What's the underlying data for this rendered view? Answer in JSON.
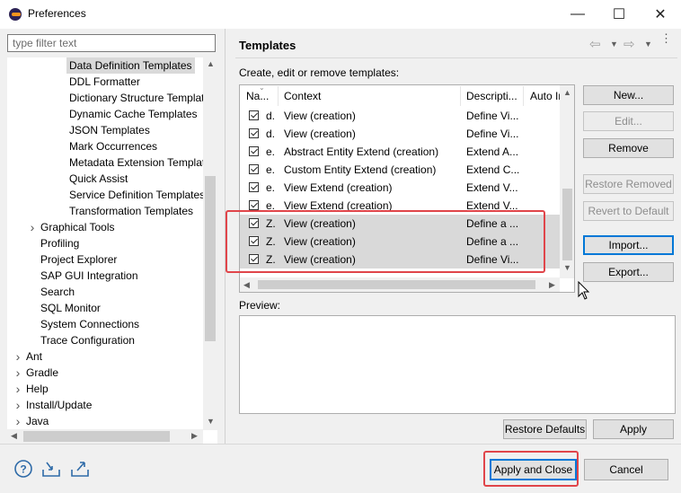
{
  "window": {
    "title": "Preferences",
    "controls": {
      "minimize": "—",
      "maximize": "☐",
      "close": "✕"
    }
  },
  "filter": {
    "placeholder": "type filter text",
    "value": ""
  },
  "tree": {
    "items": [
      {
        "label": "Data Definition Templates",
        "selected": true
      },
      {
        "label": "DDL Formatter"
      },
      {
        "label": "Dictionary Structure Templat"
      },
      {
        "label": "Dynamic Cache Templates"
      },
      {
        "label": "JSON Templates"
      },
      {
        "label": "Mark Occurrences"
      },
      {
        "label": "Metadata Extension Templat"
      },
      {
        "label": "Quick Assist"
      },
      {
        "label": "Service Definition Templates"
      },
      {
        "label": "Transformation Templates"
      },
      {
        "label": "Graphical Tools",
        "expandable": true
      },
      {
        "label": "Profiling"
      },
      {
        "label": "Project Explorer"
      },
      {
        "label": "SAP GUI Integration"
      },
      {
        "label": "Search"
      },
      {
        "label": "SQL Monitor"
      },
      {
        "label": "System Connections"
      },
      {
        "label": "Trace Configuration"
      },
      {
        "label": "Ant",
        "expandable": true
      },
      {
        "label": "Gradle",
        "expandable": true
      },
      {
        "label": "Help",
        "expandable": true
      },
      {
        "label": "Install/Update",
        "expandable": true
      },
      {
        "label": "Java",
        "expandable": true
      }
    ]
  },
  "page": {
    "title": "Templates",
    "description": "Create, edit or remove templates:",
    "nav_icons": [
      "back-arrow-icon",
      "forward-arrow-icon",
      "menu-icon"
    ]
  },
  "table": {
    "columns": [
      "Na...",
      "Context",
      "Descripti...",
      "Auto Ir"
    ],
    "rows": [
      {
        "name": "d.",
        "context": "View (creation)",
        "description": "Define Vi...",
        "checked": true,
        "selected": false
      },
      {
        "name": "d.",
        "context": "View (creation)",
        "description": "Define Vi...",
        "checked": true,
        "selected": false
      },
      {
        "name": "e.",
        "context": "Abstract Entity Extend (creation)",
        "description": "Extend A...",
        "checked": true,
        "selected": false
      },
      {
        "name": "e.",
        "context": "Custom Entity Extend (creation)",
        "description": "Extend C...",
        "checked": true,
        "selected": false
      },
      {
        "name": "e.",
        "context": "View Extend (creation)",
        "description": "Extend V...",
        "checked": true,
        "selected": false
      },
      {
        "name": "e.",
        "context": "View Extend (creation)",
        "description": "Extend V...",
        "checked": true,
        "selected": false
      },
      {
        "name": "Z.",
        "context": "View (creation)",
        "description": "Define a ...",
        "checked": true,
        "selected": true
      },
      {
        "name": "Z.",
        "context": "View (creation)",
        "description": "Define a ...",
        "checked": true,
        "selected": true
      },
      {
        "name": "Z.",
        "context": "View (creation)",
        "description": "Define Vi...",
        "checked": true,
        "selected": true
      }
    ]
  },
  "side_buttons": {
    "new": "New...",
    "edit": "Edit...",
    "remove": "Remove",
    "restore_removed": "Restore Removed",
    "revert_to_default": "Revert to Default",
    "import": "Import...",
    "export": "Export..."
  },
  "preview": {
    "label": "Preview:"
  },
  "page_buttons": {
    "restore_defaults": "Restore Defaults",
    "apply": "Apply"
  },
  "footer": {
    "icons": [
      "help-icon",
      "import-icon",
      "export-icon"
    ],
    "apply_and_close": "Apply and Close",
    "cancel": "Cancel"
  },
  "colors": {
    "highlight": "#e0454a",
    "selection": "#d9d9d9",
    "focus": "#0078d7"
  }
}
